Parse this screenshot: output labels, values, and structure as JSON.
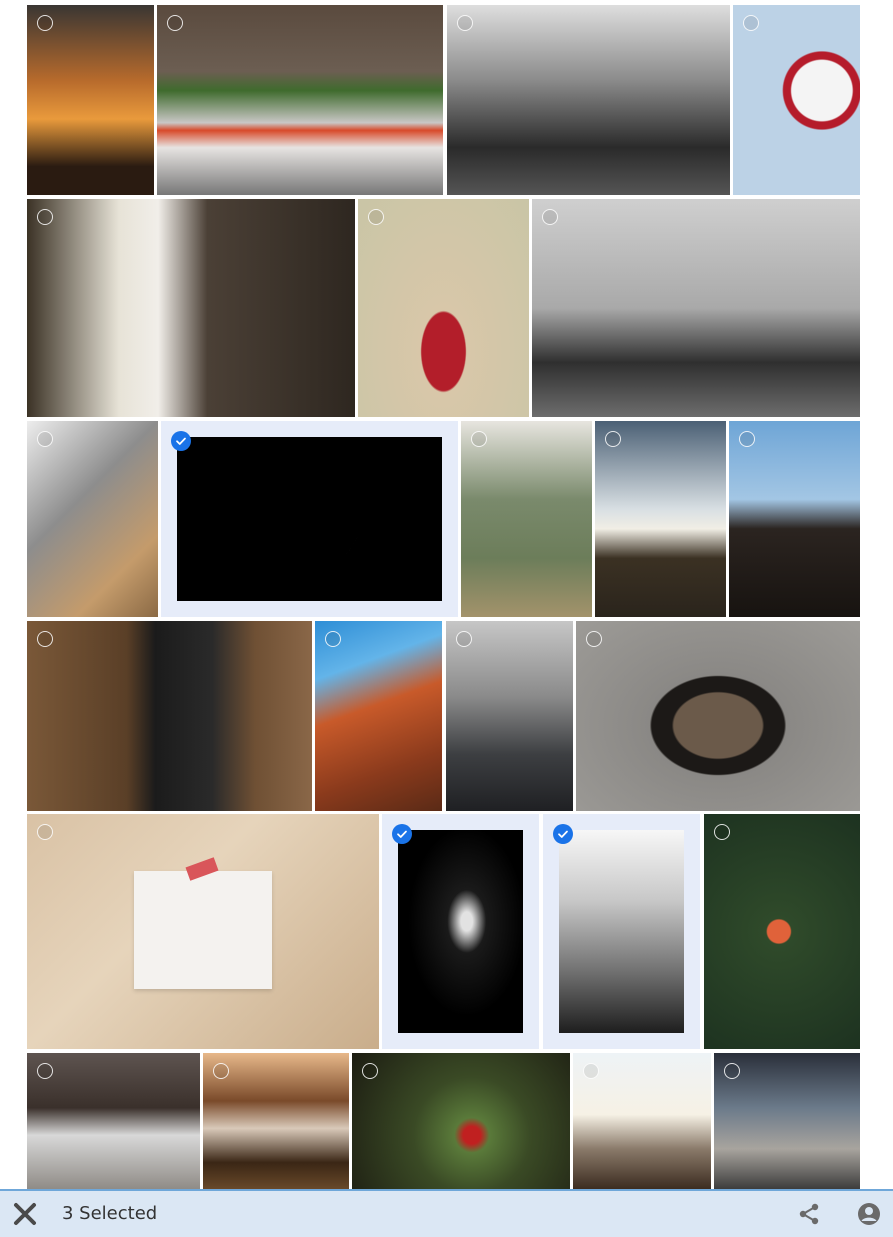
{
  "photos": [
    {
      "id": 1,
      "selected": false
    },
    {
      "id": 2,
      "selected": false
    },
    {
      "id": 3,
      "selected": false
    },
    {
      "id": 4,
      "selected": false
    },
    {
      "id": 5,
      "selected": false
    },
    {
      "id": 6,
      "selected": false
    },
    {
      "id": 7,
      "selected": false
    },
    {
      "id": 8,
      "selected": false
    },
    {
      "id": 9,
      "selected": true
    },
    {
      "id": 10,
      "selected": false
    },
    {
      "id": 11,
      "selected": false
    },
    {
      "id": 12,
      "selected": false
    },
    {
      "id": 13,
      "selected": false
    },
    {
      "id": 14,
      "selected": false
    },
    {
      "id": 15,
      "selected": false
    },
    {
      "id": 16,
      "selected": false
    },
    {
      "id": 17,
      "selected": false
    },
    {
      "id": 18,
      "selected": true
    },
    {
      "id": 19,
      "selected": true
    },
    {
      "id": 20,
      "selected": false
    },
    {
      "id": 21,
      "selected": false
    },
    {
      "id": 22,
      "selected": false
    },
    {
      "id": 23,
      "selected": false
    },
    {
      "id": 24,
      "selected": false
    },
    {
      "id": 25,
      "selected": false
    }
  ],
  "selection_bar": {
    "count_label": "3 Selected",
    "close_icon": "close-icon",
    "share_icon": "share-icon",
    "account_icon": "account-icon",
    "accent_color": "#1a73e8"
  }
}
